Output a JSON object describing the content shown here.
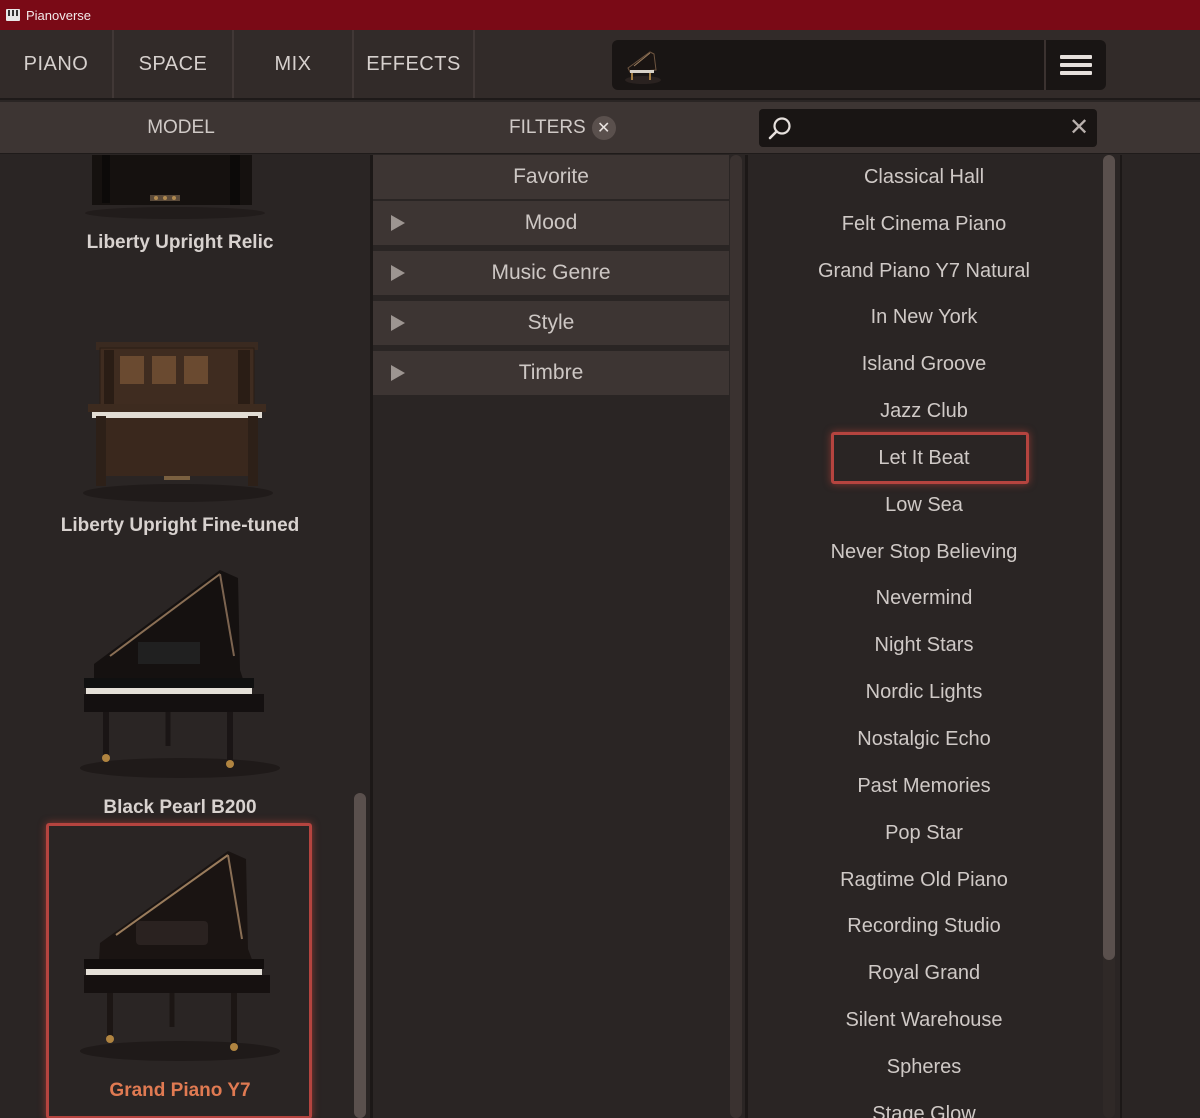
{
  "titlebar": {
    "title": "Pianoverse"
  },
  "nav": {
    "tabs": [
      {
        "label": "PIANO"
      },
      {
        "label": "SPACE"
      },
      {
        "label": "MIX"
      },
      {
        "label": "EFFECTS"
      }
    ]
  },
  "subheader": {
    "model_label": "MODEL",
    "filters_label": "FILTERS",
    "filters_clear": "✕",
    "search_value": "",
    "search_clear": "✕"
  },
  "models": [
    {
      "name": "Liberty Upright Relic"
    },
    {
      "name": "Liberty Upright Fine-tuned"
    },
    {
      "name": "Black Pearl B200"
    },
    {
      "name": "Grand Piano Y7",
      "selected": true
    }
  ],
  "filters": [
    {
      "label": "Favorite",
      "expandable": false
    },
    {
      "label": "Mood",
      "expandable": true
    },
    {
      "label": "Music Genre",
      "expandable": true
    },
    {
      "label": "Style",
      "expandable": true
    },
    {
      "label": "Timbre",
      "expandable": true
    }
  ],
  "presets": [
    "Classical Hall",
    "Felt Cinema Piano",
    "Grand Piano Y7 Natural",
    "In New York",
    "Island Groove",
    "Jazz Club",
    "Let It Beat",
    "Low Sea",
    "Never Stop Believing",
    "Nevermind",
    "Night Stars",
    "Nordic Lights",
    "Nostalgic Echo",
    "Past Memories",
    "Pop Star",
    "Ragtime Old Piano",
    "Recording Studio",
    "Royal Grand",
    "Silent Warehouse",
    "Spheres",
    "Stage Glow"
  ],
  "highlighted_preset": "Let It Beat",
  "colors": {
    "titlebar": "#7a0a16",
    "highlight": "#b5443f",
    "selected_text": "#e07a52"
  }
}
